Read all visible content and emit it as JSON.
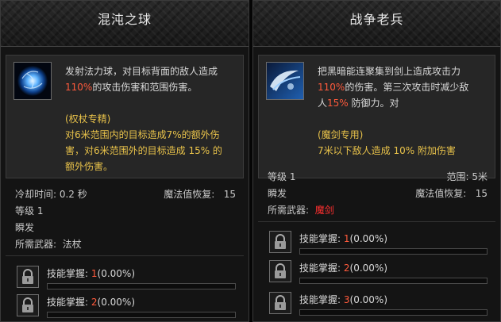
{
  "cards": [
    {
      "title": "混沌之球",
      "description": {
        "line1": "发射法力球，对目标背面的敌人造成",
        "dmg_percent": "110%",
        "line2_rest": "的攻击伤害和范围伤害。",
        "spec_title": "(权杖专精)",
        "spec_line1": "对6米范围内的目标造成7%的额外伤",
        "spec_line2": "害，对6米范围外的目标造成 15% 的",
        "spec_line3": "额外伤害。"
      },
      "stats": {
        "cooldown_label": "冷却时间: 0.2 秒",
        "mana_regen_label": "魔法值恢复:",
        "mana_regen_value": "15",
        "level": "等级 1",
        "cast_type": "瞬发",
        "weapon_label": "所需武器:",
        "weapon_value": "法杖"
      },
      "mastery": [
        {
          "label": "技能掌握:",
          "level": "1",
          "percent_text": "(0.00%)",
          "progress": 0
        },
        {
          "label": "技能掌握:",
          "level": "2",
          "percent_text": "(0.00%)",
          "progress": 0
        }
      ]
    },
    {
      "title": "战争老兵",
      "description": {
        "line1": "把黑暗能连聚集到剑上造成攻击力",
        "dmg_percent": "110%",
        "line2_rest": "的伤害。第三次攻击时减少敌",
        "line3_pre": "人",
        "def_percent": "15%",
        "line3_rest": "防御力。对",
        "spec_title": "(魔剑专用)",
        "spec_line1": "7米以下敌人造成 10% 附加伤害"
      },
      "stats": {
        "level": "等级 1",
        "range": "范围: 5米",
        "cast_type": "瞬发",
        "mana_regen_label": "魔法值恢复:",
        "mana_regen_value": "15",
        "weapon_label": "所需武器:",
        "weapon_value": "魔剑"
      },
      "mastery": [
        {
          "label": "技能掌握:",
          "level": "1",
          "percent_text": "(0.00%)",
          "progress": 0
        },
        {
          "label": "技能掌握:",
          "level": "2",
          "percent_text": "(0.00%)",
          "progress": 0
        },
        {
          "label": "技能掌握:",
          "level": "3",
          "percent_text": "(0.00%)",
          "progress": 0
        }
      ]
    }
  ],
  "icons": {
    "left_skill": "chaos-orb-icon",
    "right_skill": "war-veteran-slash-icon",
    "mastery": "lock-icon"
  },
  "colors": {
    "highlight_red": "#ff5a3c",
    "spec_gold": "#e8c24a",
    "weapon_red": "#ff2f2f"
  }
}
